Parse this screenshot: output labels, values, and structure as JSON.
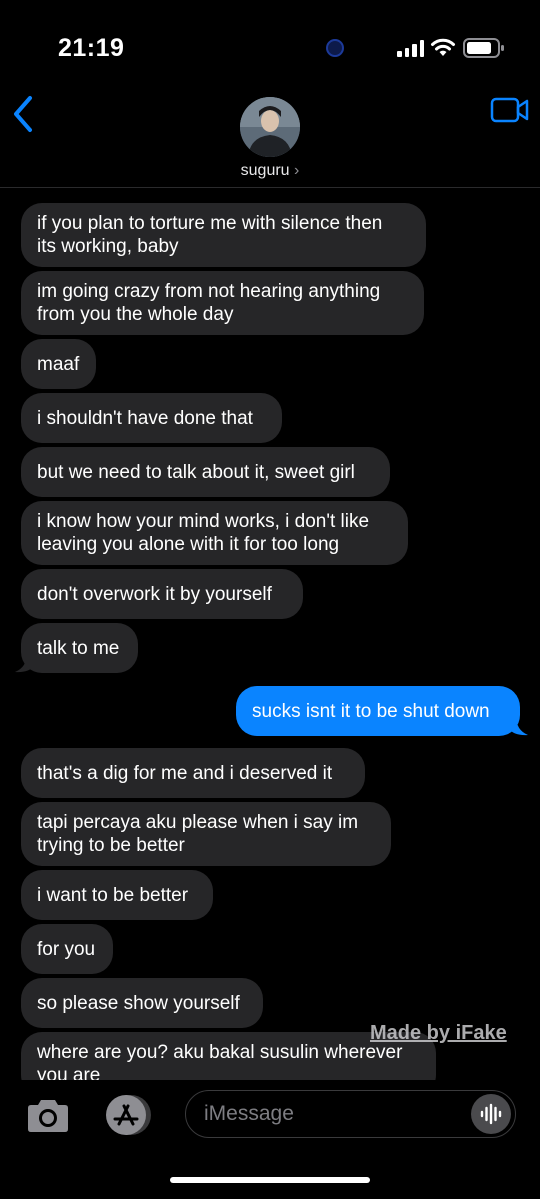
{
  "status_bar": {
    "time": "21:19"
  },
  "header": {
    "contact_name": "suguru",
    "name_chevron": "›"
  },
  "messages": [
    {
      "dir": "in",
      "lines": [
        "if you plan to torture me with silence then",
        "its working, baby"
      ]
    },
    {
      "dir": "in",
      "lines": [
        "im going crazy from not hearing anything",
        "from you the whole day"
      ]
    },
    {
      "dir": "in",
      "lines": [
        "maaf"
      ]
    },
    {
      "dir": "in",
      "lines": [
        "i shouldn't have done that"
      ]
    },
    {
      "dir": "in",
      "lines": [
        "but we need to talk about it, sweet girl"
      ]
    },
    {
      "dir": "in",
      "lines": [
        "i know how your mind works, i don't like",
        "leaving you alone with it for too long"
      ]
    },
    {
      "dir": "in",
      "lines": [
        "don't overwork it by yourself"
      ]
    },
    {
      "dir": "in",
      "lines": [
        "talk to me"
      ]
    },
    {
      "dir": "out",
      "lines": [
        "sucks isnt it to be shut down"
      ]
    },
    {
      "dir": "in",
      "lines": [
        "that's a dig for me and i deserved it"
      ]
    },
    {
      "dir": "in",
      "lines": [
        "tapi percaya aku please when i say im",
        "trying to be better"
      ]
    },
    {
      "dir": "in",
      "lines": [
        "i want to be better"
      ]
    },
    {
      "dir": "in",
      "lines": [
        "for you"
      ]
    },
    {
      "dir": "in",
      "lines": [
        "so please show yourself"
      ]
    },
    {
      "dir": "in",
      "lines": [
        "where are you? aku bakal susulin wherever",
        "you are"
      ]
    }
  ],
  "watermark": "Made by iFake",
  "composer": {
    "placeholder": "iMessage"
  },
  "icons": {
    "back": "chevron-left-icon",
    "video": "video-camera-icon",
    "camera": "camera-icon",
    "appstore": "app-store-icon",
    "mic": "audio-waveform-icon"
  },
  "colors": {
    "incoming_bubble": "#262628",
    "outgoing_bubble": "#0a84ff",
    "accent": "#0a84ff"
  }
}
